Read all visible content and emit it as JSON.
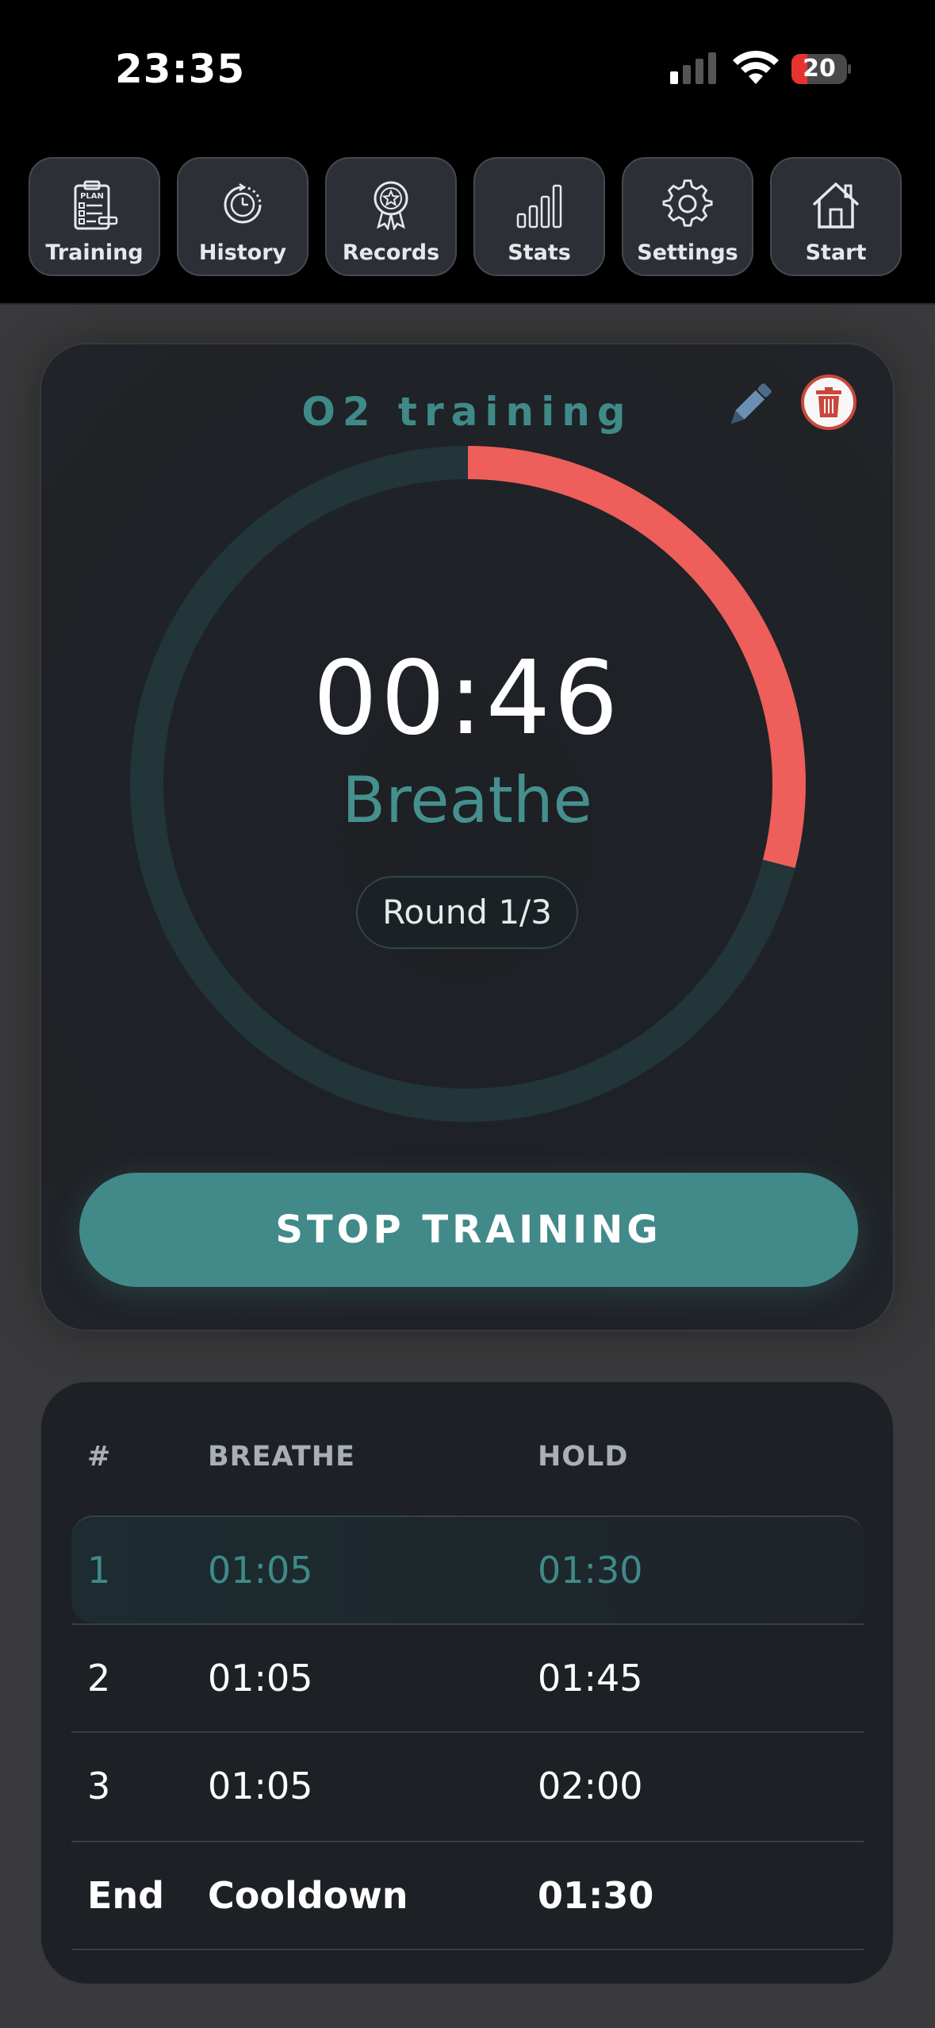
{
  "status_bar": {
    "time": "23:35",
    "battery_level": "20"
  },
  "nav": {
    "items": [
      {
        "label": "Training",
        "icon": "clipboard-plan-icon"
      },
      {
        "label": "History",
        "icon": "clock-history-icon"
      },
      {
        "label": "Records",
        "icon": "award-badge-icon"
      },
      {
        "label": "Stats",
        "icon": "bar-chart-icon"
      },
      {
        "label": "Settings",
        "icon": "gear-icon"
      },
      {
        "label": "Start",
        "icon": "home-icon"
      }
    ],
    "training_icon_text": "PLAN"
  },
  "session": {
    "title": "O2 training",
    "timer": "00:46",
    "phase": "Breathe",
    "round": "Round 1/3",
    "progress_fraction": 0.29,
    "stop_label": "STOP TRAINING",
    "colors": {
      "accent": "#418a89",
      "progress": "#ee5e5a",
      "track": "#223538"
    }
  },
  "table": {
    "headers": [
      "#",
      "BREATHE",
      "HOLD"
    ],
    "rows": [
      {
        "n": "1",
        "breathe": "01:05",
        "hold": "01:30"
      },
      {
        "n": "2",
        "breathe": "01:05",
        "hold": "01:45"
      },
      {
        "n": "3",
        "breathe": "01:05",
        "hold": "02:00"
      },
      {
        "n": "End",
        "breathe": "Cooldown",
        "hold": "01:30"
      }
    ]
  }
}
